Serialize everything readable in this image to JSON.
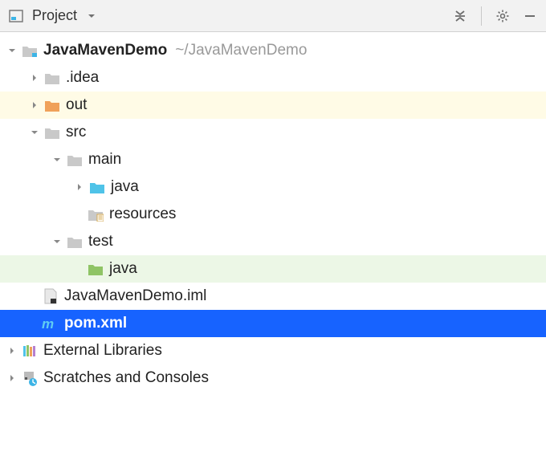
{
  "toolbar": {
    "title": "Project"
  },
  "tree": {
    "root": {
      "name": "JavaMavenDemo",
      "path": "~/JavaMavenDemo"
    },
    "idea": ".idea",
    "out": "out",
    "src": "src",
    "main": "main",
    "main_java": "java",
    "resources": "resources",
    "test": "test",
    "test_java": "java",
    "iml": "JavaMavenDemo.iml",
    "pom": "pom.xml",
    "external": "External Libraries",
    "scratches": "Scratches and Consoles"
  }
}
